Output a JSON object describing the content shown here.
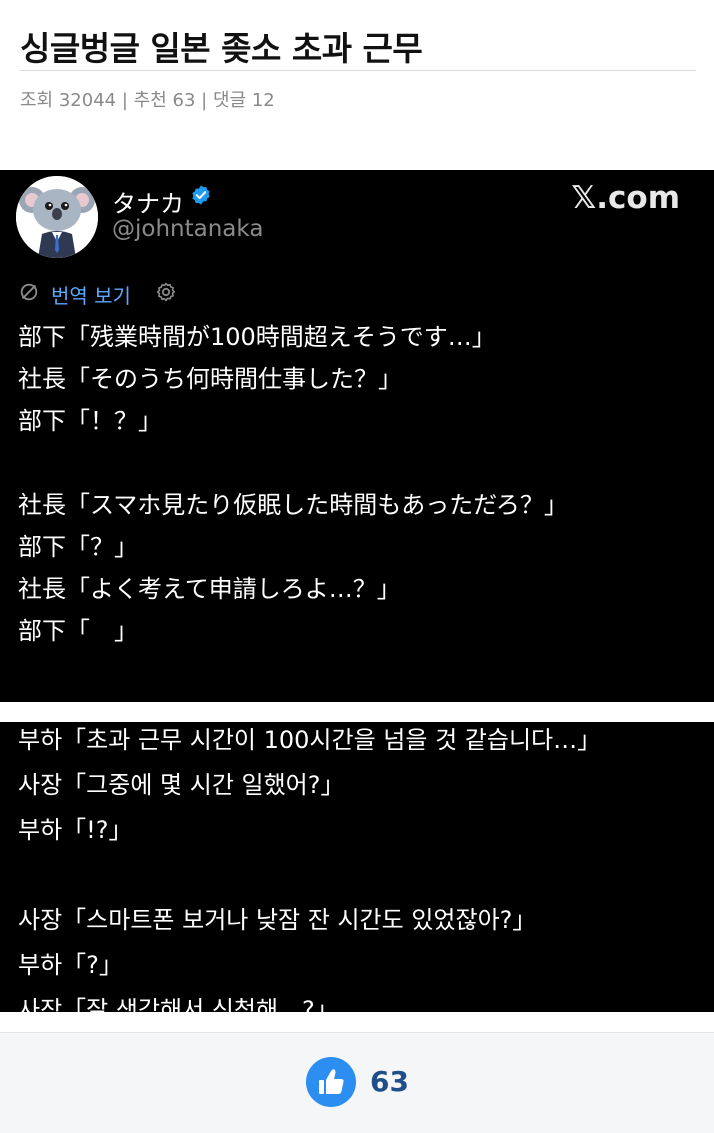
{
  "post": {
    "title": "싱글벙글 일본 좆소 초과 근무",
    "views_label": "조회",
    "views": "32044",
    "recommend_label": "추천",
    "recommend": "63",
    "comments_label": "댓글",
    "comments": "12",
    "separator": "|"
  },
  "tweet": {
    "display_name": "タナカ",
    "handle": "@johntanaka",
    "site": "𝕏.com",
    "translate_label": "번역 보기",
    "lines_jp": [
      "部下「残業時間が100時間超えそうです…」",
      "社長「そのうち何時間仕事した？」",
      "部下「！？」",
      "",
      "社長「スマホ見たり仮眠した時間もあっただろ？」",
      "部下「？」",
      "社長「よく考えて申請しろよ…？」",
      "部下「　」"
    ]
  },
  "translation": {
    "lines_ko": [
      "부하「초과 근무 시간이 100시간을 넘을 것 같습니다…」",
      "사장「그중에 몇 시간 일했어?」",
      "부하「!?」",
      "",
      "사장「스마트폰 보거나 낮잠 잔 시간도 있었잖아?」",
      "부하「?」",
      "사장「잘 생각해서 신청해…?」"
    ]
  },
  "footer": {
    "like_count": "63"
  },
  "colors": {
    "accent": "#2b8ef0",
    "translate_link": "#5aa9ff",
    "verified": "#1d9bf0"
  }
}
